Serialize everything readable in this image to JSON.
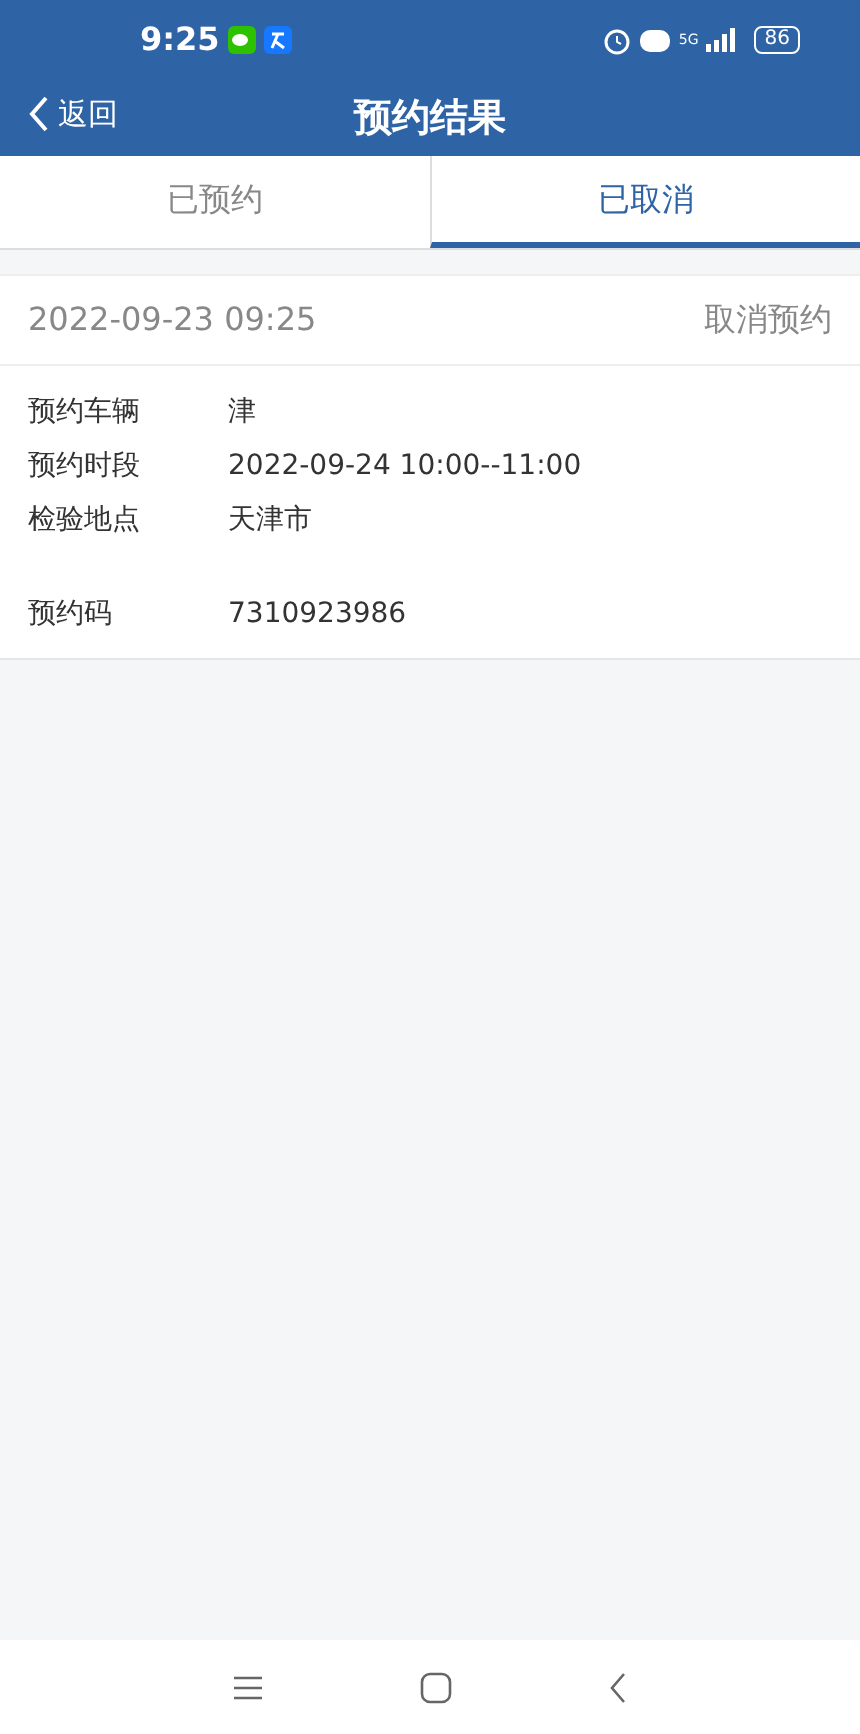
{
  "status_bar": {
    "time": "9:25",
    "battery": "86",
    "network": "5G"
  },
  "header": {
    "back": "返回",
    "title": "预约结果"
  },
  "tabs": [
    {
      "label": "已预约",
      "selected": false
    },
    {
      "label": "已取消",
      "selected": true
    }
  ],
  "record": {
    "created": "2022-09-23 09:25",
    "action": "取消预约",
    "fields": [
      {
        "label": "预约车辆",
        "value": "津"
      },
      {
        "label": "预约时段",
        "value": "2022-09-24 10:00--11:00"
      },
      {
        "label": "检验地点",
        "value": "天津市"
      },
      {
        "label": "预约码",
        "value": "7310923986"
      }
    ]
  }
}
